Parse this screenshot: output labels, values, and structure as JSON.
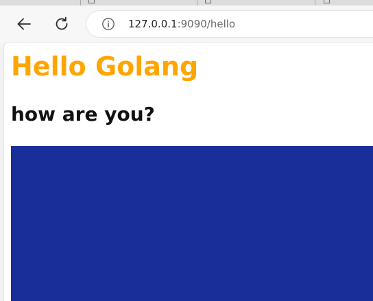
{
  "browser": {
    "address": {
      "host": "127.0.0.1",
      "rest": ":9090/hello"
    },
    "icons": {
      "back": "arrow-left-icon",
      "reload": "reload-icon",
      "info": "info-icon"
    }
  },
  "page": {
    "heading": "Hello Golang",
    "subheading": "how are you?",
    "heading_color": "#ffa500",
    "image_color": "#1a2e9a"
  }
}
